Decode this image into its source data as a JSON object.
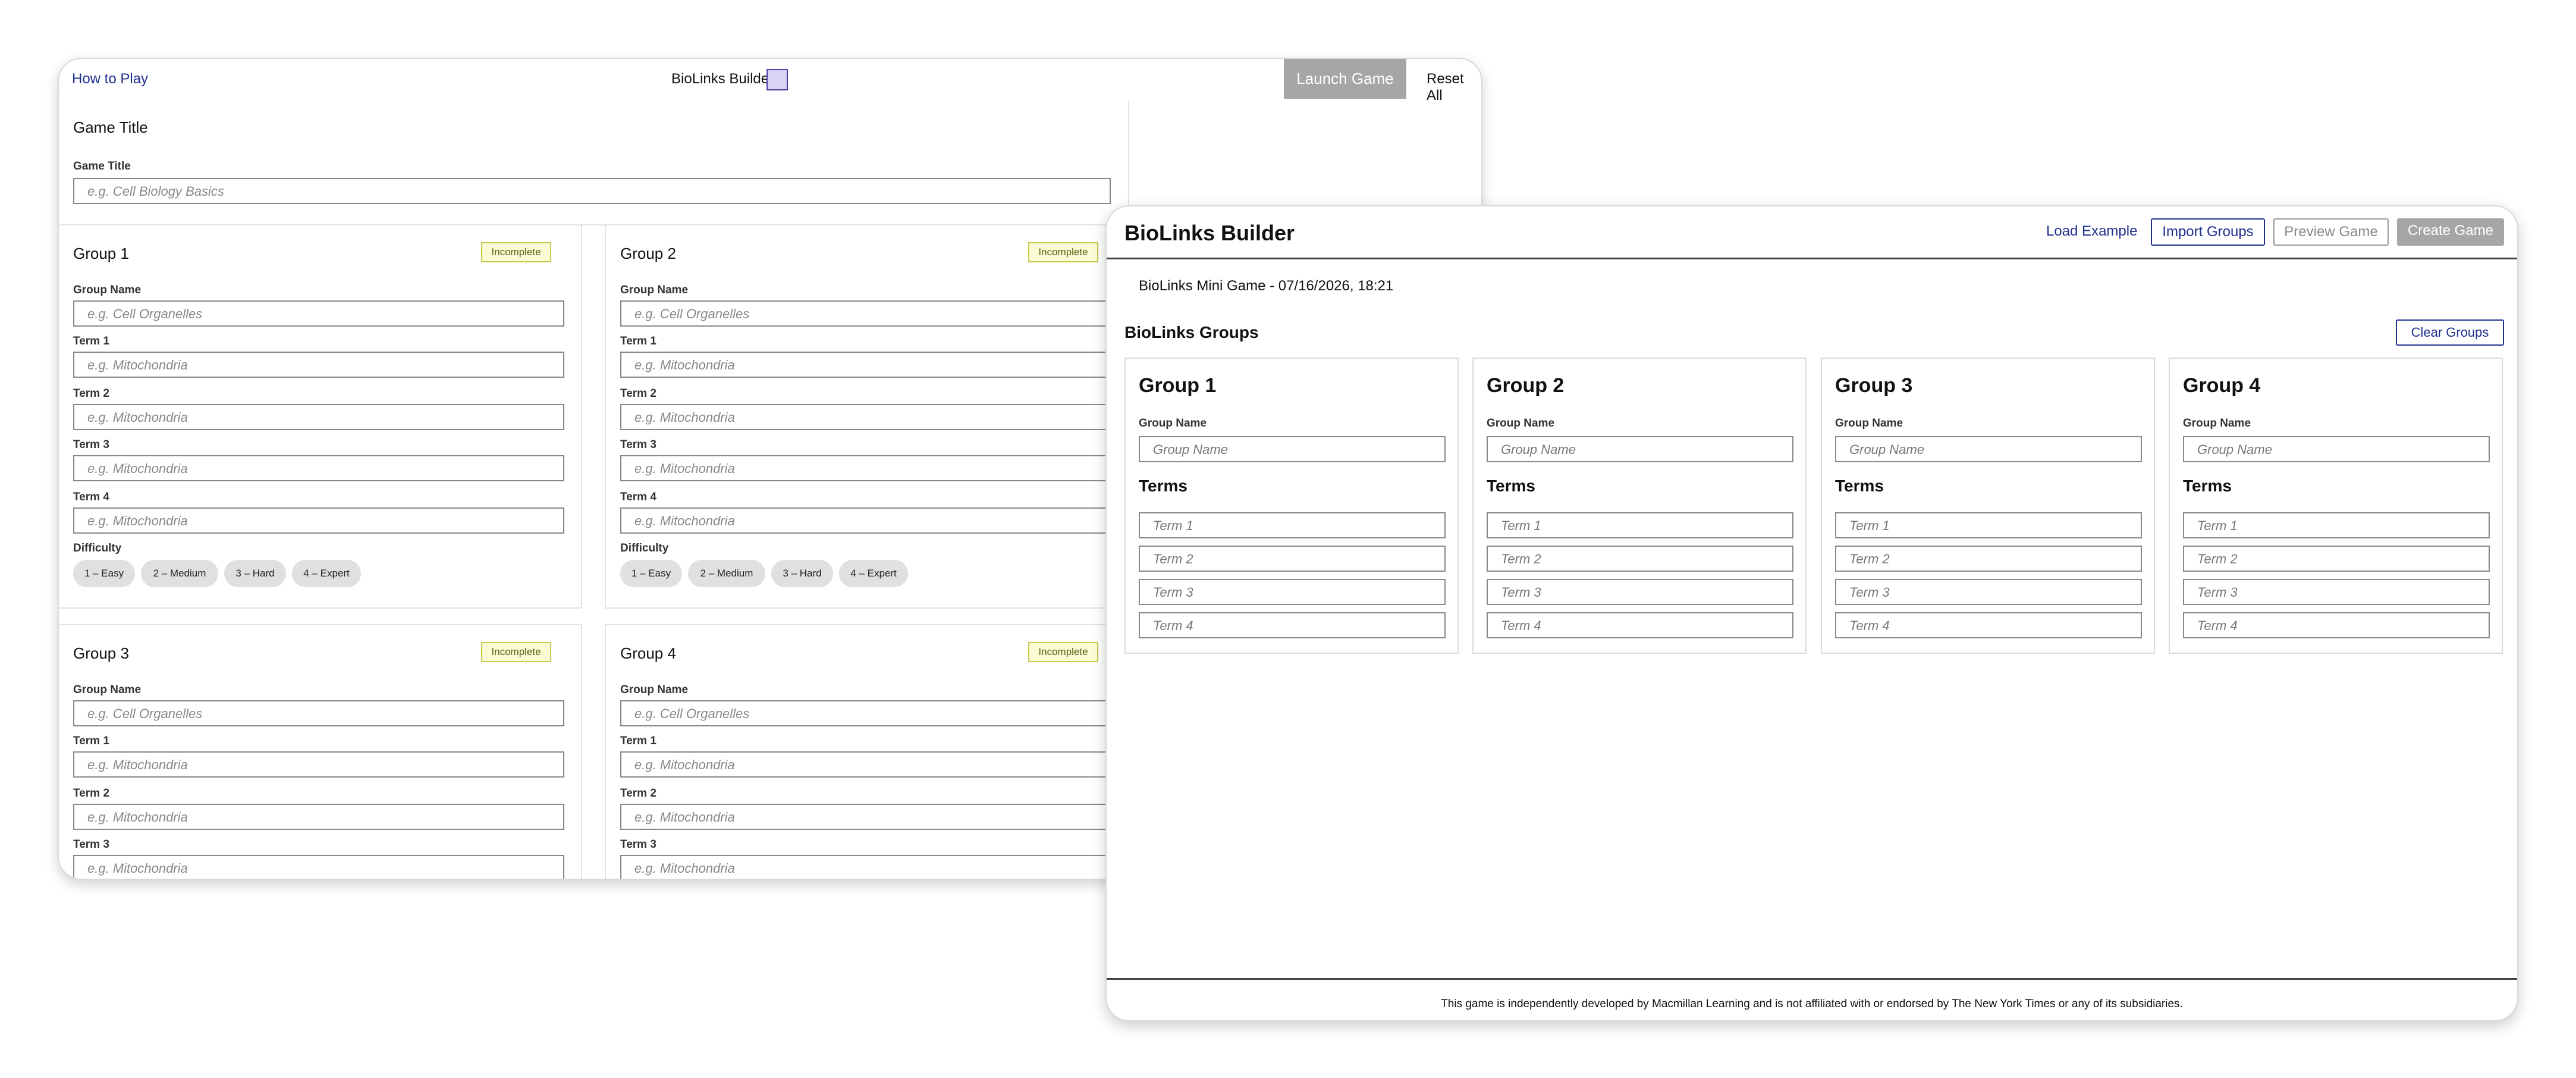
{
  "back_window": {
    "how_to_play": "How to Play",
    "title": "BioLinks Builde",
    "launch_label": "Launch Game",
    "reset_label": "Reset All",
    "game_title_card": {
      "heading": "Game Title",
      "label": "Game Title",
      "placeholder": "e.g. Cell Biology Basics"
    },
    "groups": [
      {
        "heading": "Group 1",
        "badge": "Incomplete"
      },
      {
        "heading": "Group 2",
        "badge": "Incomplete"
      },
      {
        "heading": "Group 3",
        "badge": "Incomplete"
      },
      {
        "heading": "Group 4",
        "badge": "Incomplete"
      }
    ],
    "field_labels": {
      "group_name": "Group Name",
      "term1": "Term 1",
      "term2": "Term 2",
      "term3": "Term 3",
      "term4": "Term 4",
      "difficulty": "Difficulty"
    },
    "placeholders": {
      "group_name": "e.g. Cell Organelles",
      "term": "e.g. Mitochondria",
      "term_cut": "e.g. Mitochondria"
    },
    "difficulty_options": [
      "1 – Easy",
      "2 – Medium",
      "3 – Hard",
      "4 – Expert"
    ]
  },
  "front_window": {
    "app_title": "BioLinks Builder",
    "load_example": "Load Example",
    "import_label": "Import Groups",
    "preview_label": "Preview Game",
    "create_label": "Create Game",
    "game_name": "BioLinks Mini Game - 07/16/2026, 18:21",
    "groups_title": "BioLinks Groups",
    "clear_label": "Clear Groups",
    "group_name_label": "Group Name",
    "group_name_placeholder": "Group Name",
    "terms_heading": "Terms",
    "term_placeholders": [
      "Term 1",
      "Term 2",
      "Term 3",
      "Term 4"
    ],
    "groups": [
      "Group 1",
      "Group 2",
      "Group 3",
      "Group 4"
    ],
    "disclaimer": "This game is independently developed by Macmillan Learning and is not affiliated with or endorsed by The New York Times or any of its subsidiaries."
  },
  "colors": {
    "link": "#1f2f8f",
    "disabled_button": "#a6a6a6",
    "badge_bg": "#fbfcd5",
    "badge_border": "#c6cb49",
    "cursor_fill": "#d9d4f5"
  }
}
